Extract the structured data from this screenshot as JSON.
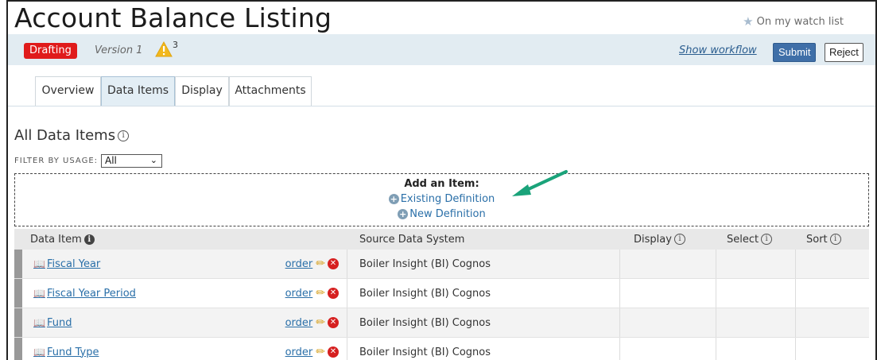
{
  "header": {
    "title": "Account Balance Listing",
    "watch_label": "On my watch list",
    "watch_icon": "star-icon"
  },
  "status_bar": {
    "status": "Drafting",
    "status_color": "#e01b1b",
    "version": "Version 1",
    "warning_count": "3",
    "show_workflow": "Show workflow",
    "submit": "Submit",
    "reject": "Reject"
  },
  "tabs": [
    {
      "label": "Overview",
      "active": false
    },
    {
      "label": "Data Items",
      "active": true
    },
    {
      "label": "Display",
      "active": false
    },
    {
      "label": "Attachments",
      "active": false
    }
  ],
  "section": {
    "title": "All Data Items",
    "filter_label": "FILTER BY USAGE:",
    "filter_value": "All"
  },
  "add_item": {
    "title": "Add an Item:",
    "existing": "Existing Definition",
    "new": "New Definition"
  },
  "table": {
    "columns": {
      "data_item": "Data Item",
      "source": "Source Data System",
      "display": "Display",
      "select": "Select",
      "sort": "Sort"
    },
    "order_label": "order",
    "rows": [
      {
        "name": "Fiscal Year",
        "source": "Boiler Insight (BI) Cognos"
      },
      {
        "name": "Fiscal Year Period",
        "source": "Boiler Insight (BI) Cognos"
      },
      {
        "name": "Fund",
        "source": "Boiler Insight (BI) Cognos"
      },
      {
        "name": "Fund Type",
        "source": "Boiler Insight (BI) Cognos"
      }
    ]
  },
  "colors": {
    "accent": "#3f6fa8",
    "link": "#2a6fa8",
    "status_bar_bg": "#e2ecf2",
    "arrow": "#1aa37a"
  }
}
